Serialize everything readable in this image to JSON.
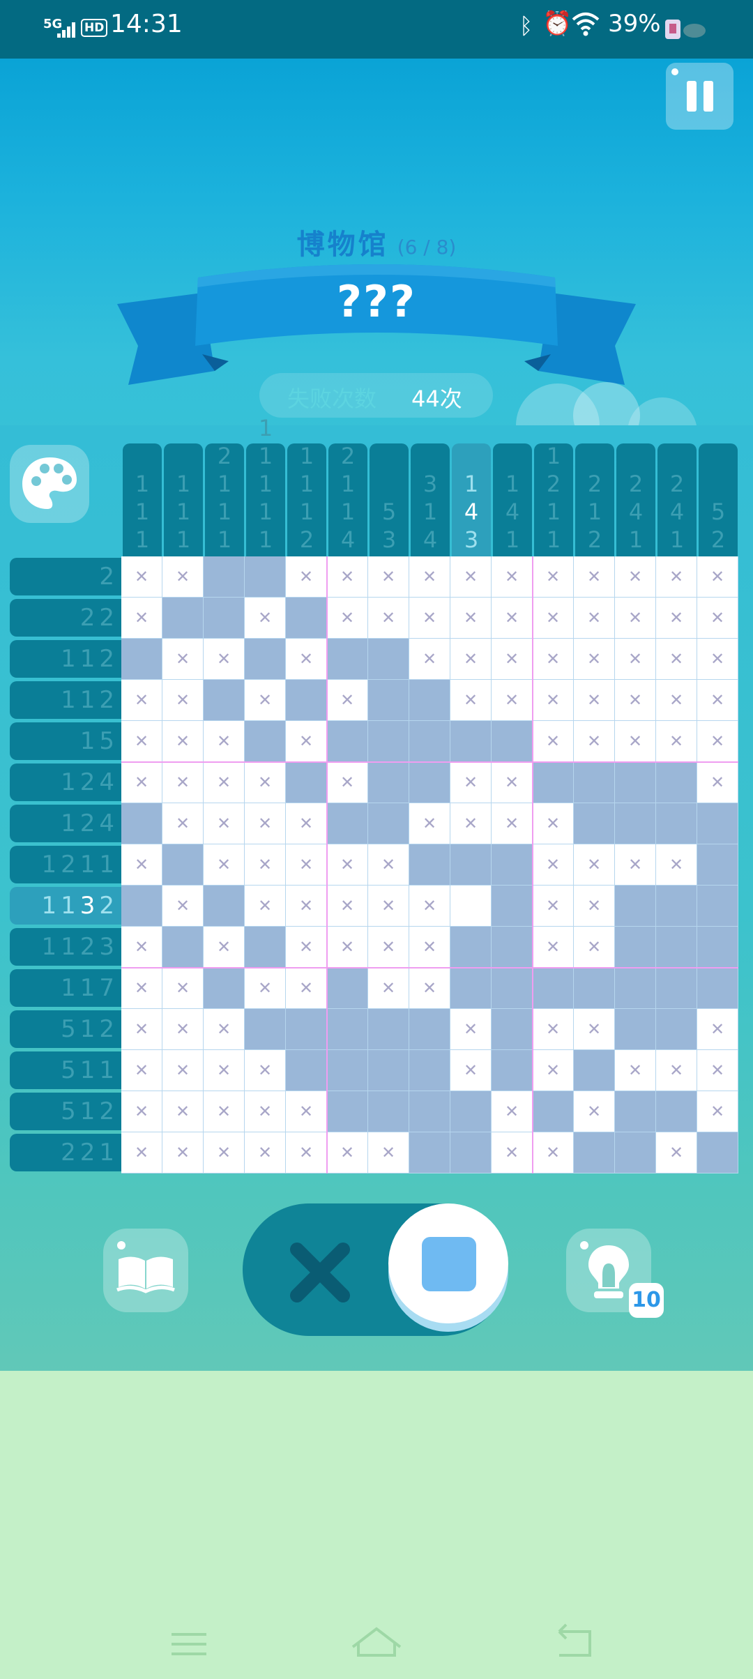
{
  "status_bar": {
    "network": "5G",
    "hd": "HD",
    "time": "14:31",
    "battery": "39%"
  },
  "game": {
    "category": "博物馆",
    "progress": "(6 / 8)",
    "puzzle_name": "???",
    "fail_label": "失败次数",
    "fail_count": "44次",
    "column_clues": [
      [
        "1",
        "1",
        "1"
      ],
      [
        "1",
        "1",
        "1"
      ],
      [
        "2",
        "1",
        "1",
        "1"
      ],
      [
        "1",
        "1",
        "1",
        "1",
        "1"
      ],
      [
        "1",
        "1",
        "1",
        "2"
      ],
      [
        "2",
        "1",
        "1",
        "4"
      ],
      [
        "5",
        "3"
      ],
      [
        "3",
        "1",
        "4"
      ],
      [
        "1",
        "4",
        "3"
      ],
      [
        "1",
        "4",
        "1"
      ],
      [
        "1",
        "2",
        "1",
        "1"
      ],
      [
        "2",
        "1",
        "2"
      ],
      [
        "2",
        "4",
        "1"
      ],
      [
        "2",
        "4",
        "1"
      ],
      [
        "5",
        "2"
      ]
    ],
    "row_clues": [
      [
        "2"
      ],
      [
        "2",
        "2"
      ],
      [
        "1",
        "1",
        "2"
      ],
      [
        "1",
        "1",
        "2"
      ],
      [
        "1",
        "5"
      ],
      [
        "1",
        "2",
        "4"
      ],
      [
        "1",
        "2",
        "4"
      ],
      [
        "1",
        "2",
        "1",
        "1"
      ],
      [
        "1",
        "1",
        "3",
        "2"
      ],
      [
        "1",
        "1",
        "2",
        "3"
      ],
      [
        "1",
        "1",
        "7"
      ],
      [
        "5",
        "1",
        "2"
      ],
      [
        "5",
        "1",
        "1"
      ],
      [
        "5",
        "1",
        "2"
      ],
      [
        "2",
        "2",
        "1"
      ]
    ],
    "highlight_column": 8,
    "highlight_row": 8,
    "highlight_column_current_clue": 1,
    "highlight_row_current_clue": 2,
    "grid_rows": [
      "xxffxxxxxxxxxxx",
      "xffxfxxxxxxxxxx",
      "fxxfxffxxxxxxxx",
      "xxfxfxffxxxxxxx",
      "xxxfxfffffxxxxx",
      "xxxxfxffxxffffx",
      "fxxxxffxxxxffff",
      "xfxxxxxfffxxxxf",
      "fxfxxxxx.fxxfff",
      "xfxfxxxxffxxfff",
      "xxfxxfxxffffff",
      "xxxfffffxfxxffx",
      "xxxxffffxfxfxxx",
      "xxxxxffffxfxffx",
      "xxxxxxxffxxffxf"
    ],
    "grid_legend": {
      "f": "filled",
      "x": "crossed",
      ".": "empty"
    },
    "controls": {
      "tool_selected": "fill",
      "hint_count": "10"
    },
    "colors": {
      "filled": "#9ab7d8",
      "cross": "#a8a6c8",
      "accent": "#2d97e8",
      "divider": "#ef9df0"
    },
    "icons": [
      "pause-icon",
      "palette-icon",
      "book-icon",
      "cross-icon",
      "fill-square-icon",
      "hint-bulb-icon",
      "menu-icon",
      "home-icon",
      "back-icon"
    ]
  }
}
